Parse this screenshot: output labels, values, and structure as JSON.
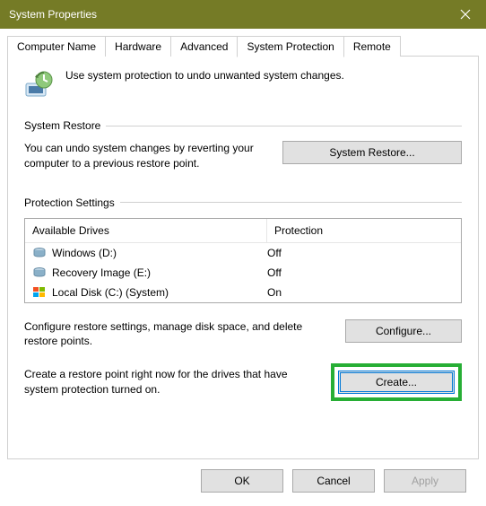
{
  "title": "System Properties",
  "tabs": [
    "Computer Name",
    "Hardware",
    "Advanced",
    "System Protection",
    "Remote"
  ],
  "active_tab": 3,
  "intro_text": "Use system protection to undo unwanted system changes.",
  "section_restore": {
    "title": "System Restore",
    "desc": "You can undo system changes by reverting your computer to a previous restore point.",
    "button": "System Restore..."
  },
  "section_protection": {
    "title": "Protection Settings",
    "headers": [
      "Available Drives",
      "Protection"
    ],
    "drives": [
      {
        "name": "Windows (D:)",
        "protection": "Off",
        "icon": "hdd"
      },
      {
        "name": "Recovery Image (E:)",
        "protection": "Off",
        "icon": "hdd"
      },
      {
        "name": "Local Disk (C:) (System)",
        "protection": "On",
        "icon": "win"
      }
    ],
    "configure_desc": "Configure restore settings, manage disk space, and delete restore points.",
    "configure_button": "Configure...",
    "create_desc": "Create a restore point right now for the drives that have system protection turned on.",
    "create_button": "Create..."
  },
  "bottom": {
    "ok": "OK",
    "cancel": "Cancel",
    "apply": "Apply"
  }
}
